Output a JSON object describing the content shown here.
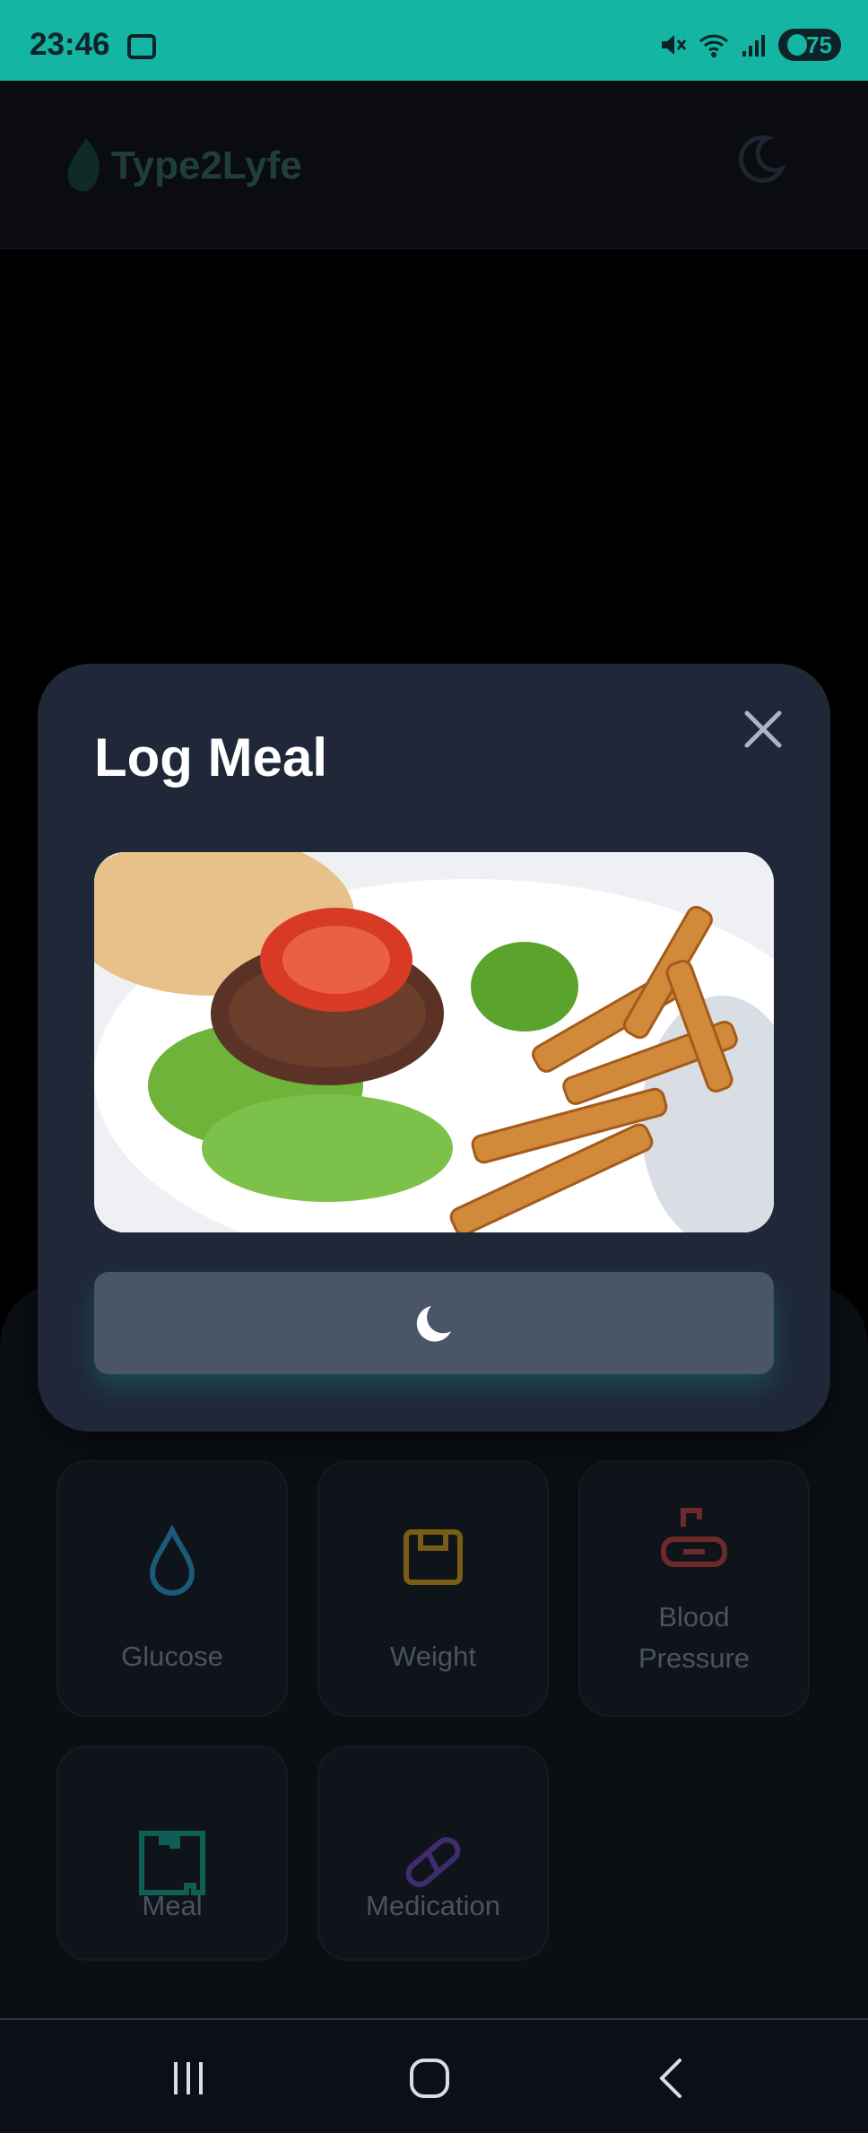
{
  "status_bar": {
    "time": "23:46",
    "battery": "75",
    "icons": [
      "screen-record-icon",
      "mute-icon",
      "wifi-icon",
      "signal-icon",
      "battery-icon"
    ]
  },
  "app": {
    "brand": "Type2Lyfe",
    "theme_toggle_icon": "moon-icon",
    "accent_color": "#14b5a3"
  },
  "modal": {
    "title": "Log Meal",
    "close_icon": "close-icon",
    "photo": "burger-and-fries-photo",
    "submit_state": "loading"
  },
  "dashboard": {
    "tiles": [
      {
        "label": "Glucose",
        "icon": "droplet-icon",
        "color": "#1b5a7a"
      },
      {
        "label": "Weight",
        "icon": "scale-icon",
        "color": "#7a5d14"
      },
      {
        "label": "Blood\nPressure",
        "icon": "blood-pressure-icon",
        "color": "#6e2a2a"
      },
      {
        "label": "Meal",
        "icon": "meal-icon",
        "color": "#0f5e55"
      },
      {
        "label": "Medication",
        "icon": "pill-icon",
        "color": "#3f2c6e"
      }
    ]
  },
  "nav": {
    "buttons": [
      "recents-icon",
      "home-icon",
      "back-icon"
    ]
  }
}
